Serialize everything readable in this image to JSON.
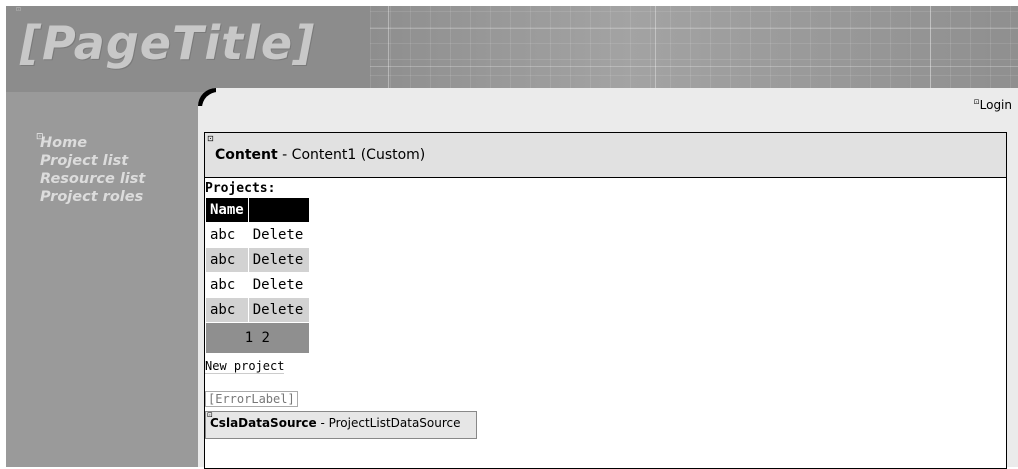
{
  "header": {
    "page_title": "[PageTitle]"
  },
  "nav": {
    "items": [
      "Home",
      "Project list",
      "Resource list",
      "Project roles"
    ]
  },
  "login": {
    "label": "Login"
  },
  "content": {
    "title_bold": "Content",
    "title_rest": " - Content1 (Custom)",
    "projects_label": "Projects:",
    "grid": {
      "headers": [
        "Name",
        ""
      ],
      "rows": [
        {
          "name": "abc",
          "action": "Delete"
        },
        {
          "name": "abc",
          "action": "Delete"
        },
        {
          "name": "abc",
          "action": "Delete"
        },
        {
          "name": "abc",
          "action": "Delete"
        }
      ],
      "pager": "1 2"
    },
    "new_project": "New project",
    "error_label": "[ErrorLabel]",
    "datasource": {
      "type": "CslaDataSource",
      "name": " - ProjectListDataSource"
    }
  }
}
